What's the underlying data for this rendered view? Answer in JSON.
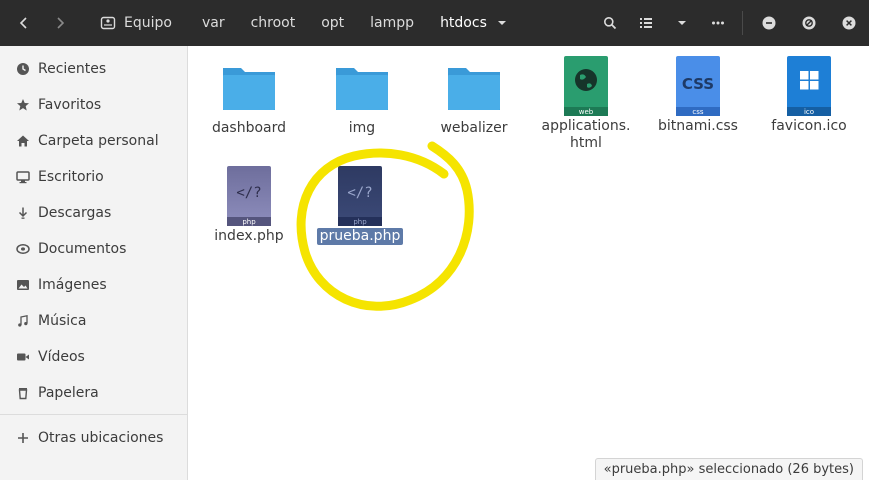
{
  "header": {
    "breadcrumbs": [
      "Equipo",
      "var",
      "chroot",
      "opt",
      "lampp",
      "htdocs"
    ]
  },
  "sidebar": {
    "items": [
      {
        "label": "Recientes",
        "icon": "clock-icon"
      },
      {
        "label": "Favoritos",
        "icon": "star-icon"
      },
      {
        "label": "Carpeta personal",
        "icon": "home-icon"
      },
      {
        "label": "Escritorio",
        "icon": "desktop-icon"
      },
      {
        "label": "Descargas",
        "icon": "download-icon"
      },
      {
        "label": "Documentos",
        "icon": "documents-icon"
      },
      {
        "label": "Imágenes",
        "icon": "image-icon"
      },
      {
        "label": "Música",
        "icon": "music-icon"
      },
      {
        "label": "Vídeos",
        "icon": "video-icon"
      },
      {
        "label": "Papelera",
        "icon": "trash-icon"
      },
      {
        "label": "Otras ubicaciones",
        "icon": "plus-icon"
      }
    ]
  },
  "files": [
    {
      "name": "dashboard",
      "type": "folder"
    },
    {
      "name": "img",
      "type": "folder"
    },
    {
      "name": "webalizer",
      "type": "folder"
    },
    {
      "name": "applications.\nhtml",
      "type": "html",
      "badge": "web"
    },
    {
      "name": "bitnami.css",
      "type": "css",
      "badge": "css",
      "glyph": "CSS"
    },
    {
      "name": "favicon.ico",
      "type": "ico",
      "badge": "ico"
    },
    {
      "name": "index.php",
      "type": "php",
      "badge": "php",
      "glyph": "</?"
    },
    {
      "name": "prueba.php",
      "type": "php",
      "badge": "php",
      "glyph": "</?",
      "selected": true
    }
  ],
  "status": {
    "text": "«prueba.php» seleccionado  (26 bytes)"
  },
  "colors": {
    "headerbar": "#2c2c2c",
    "folder": "#4aaee8",
    "selection": "#5e7aa8",
    "highlight_circle": "#f5e400"
  }
}
